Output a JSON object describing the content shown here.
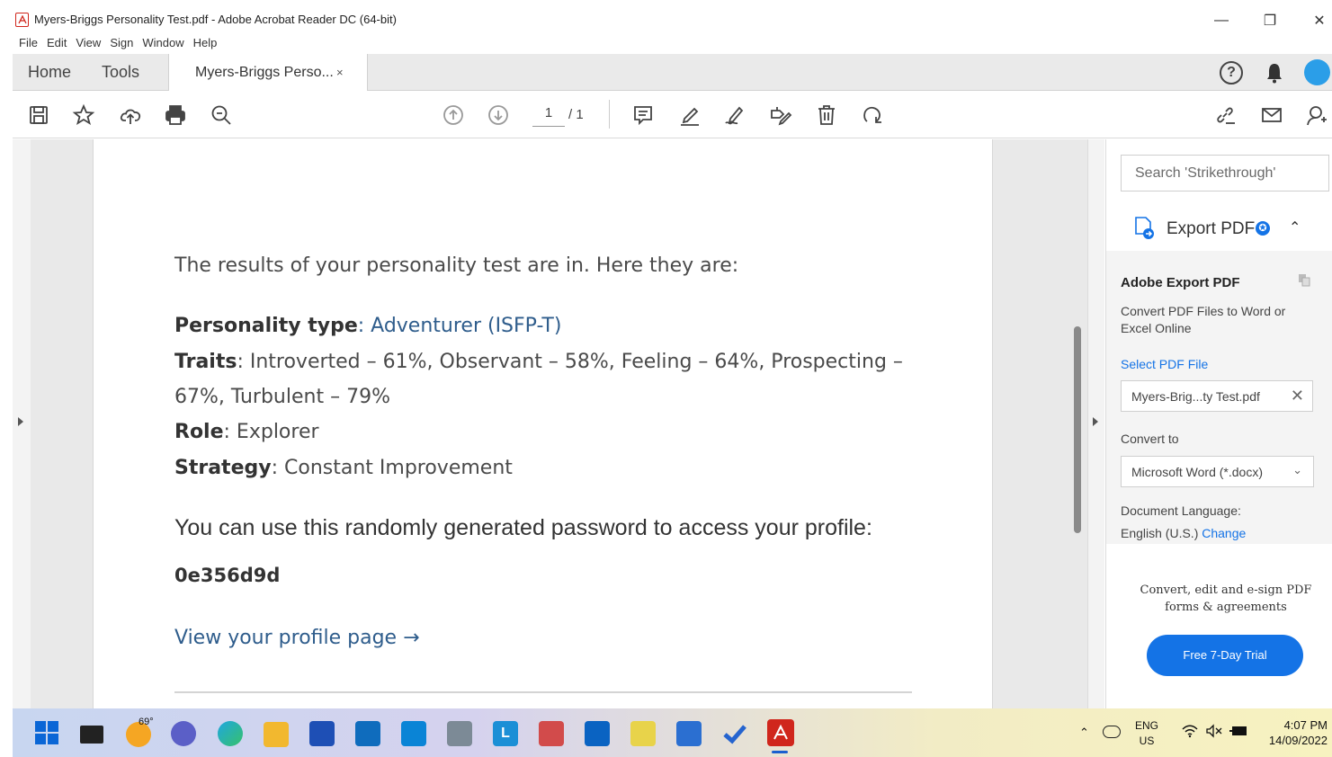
{
  "window": {
    "title": "Myers-Briggs Personality Test.pdf - Adobe Acrobat Reader DC (64-bit)",
    "controls": [
      "—",
      "❐",
      "✕"
    ]
  },
  "menu": [
    "File",
    "Edit",
    "View",
    "Sign",
    "Window",
    "Help"
  ],
  "tabs": {
    "home": "Home",
    "tools": "Tools",
    "doc": "Myers-Briggs Perso...",
    "close": "×"
  },
  "toolbar": {
    "page_current": "1",
    "page_total": "/ 1"
  },
  "document": {
    "intro": "The results of your personality test are in. Here they are:",
    "personality_label": "Personality type",
    "personality_value": ": Adventurer (ISFP-T)",
    "traits_label": "Traits",
    "traits_line1": ": Introverted – 61%, Observant – 58%, Feeling – 64%, Prospecting –",
    "traits_line2": "67%, Turbulent – 79%",
    "role_label": "Role",
    "role_value": ": Explorer",
    "strategy_label": "Strategy",
    "strategy_value": ": Constant Improvement",
    "password_intro": "You can use this randomly generated password to access your profile:",
    "password": "0e356d9d",
    "profile_link": "View your profile page →"
  },
  "right_panel": {
    "search_placeholder": "Search 'Strikethrough'",
    "export_label": "Export PDF",
    "export_title": "Adobe Export PDF",
    "export_desc": "Convert PDF Files to Word or Excel Online",
    "select_file": "Select PDF File",
    "file_name": "Myers-Brig...ty Test.pdf",
    "convert_to_label": "Convert to",
    "convert_to_value": "Microsoft Word (*.docx)",
    "doc_lang_label": "Document Language:",
    "doc_lang_value": "English (U.S.)",
    "doc_lang_change": "Change",
    "promo": "Convert, edit and e-sign PDF forms & agreements",
    "trial_button": "Free 7-Day Trial"
  },
  "taskbar": {
    "weather": "69°",
    "lang_top": "ENG",
    "lang_bottom": "US",
    "time": "4:07 PM",
    "date": "14/09/2022"
  },
  "colors": {
    "accent": "#1473e6",
    "link": "#2f5d8c",
    "acrobat_red": "#d0261c"
  }
}
